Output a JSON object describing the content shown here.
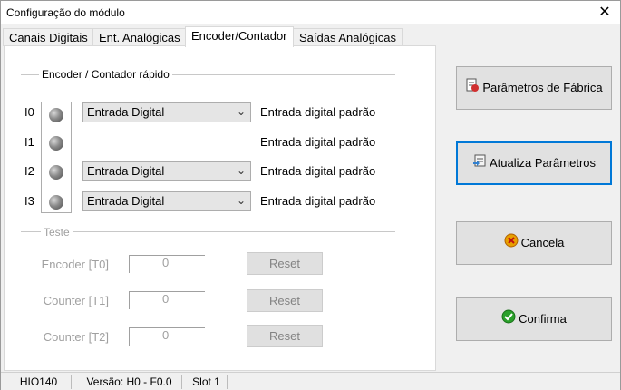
{
  "window": {
    "title": "Configuração do módulo",
    "close_glyph": "✕"
  },
  "tabs": [
    {
      "label": "Canais Digitais"
    },
    {
      "label": "Ent. Analógicas"
    },
    {
      "label": "Encoder/Contador"
    },
    {
      "label": "Saídas Analógicas"
    }
  ],
  "active_tab": "Encoder/Contador",
  "encoder": {
    "group_title": "Encoder / Contador rápido",
    "rows": [
      {
        "label": "I0",
        "select": "Entrada Digital",
        "desc": "Entrada digital padrão"
      },
      {
        "label": "I1",
        "desc": "Entrada digital padrão"
      },
      {
        "label": "I2",
        "select": "Entrada Digital",
        "desc": "Entrada digital padrão"
      },
      {
        "label": "I3",
        "select": "Entrada Digital",
        "desc": "Entrada digital padrão"
      }
    ]
  },
  "test": {
    "group_title": "Teste",
    "rows": [
      {
        "label": "Encoder [T0]",
        "value": "0",
        "button": "Reset"
      },
      {
        "label": "Counter [T1]",
        "value": "0",
        "button": "Reset"
      },
      {
        "label": "Counter [T2]",
        "value": "0",
        "button": "Reset"
      }
    ]
  },
  "buttons": {
    "factory": "Parâmetros de Fábrica",
    "update": "Atualiza Parâmetros",
    "cancel": "Cancela",
    "confirm": "Confirma"
  },
  "status": {
    "module": "HIO140",
    "version": "Versão: H0 - F0.0",
    "slot": "Slot 1"
  },
  "colors": {
    "focus_border": "#0078d7",
    "cancel_icon": "#e8a000",
    "confirm_icon": "#2aa02a"
  }
}
